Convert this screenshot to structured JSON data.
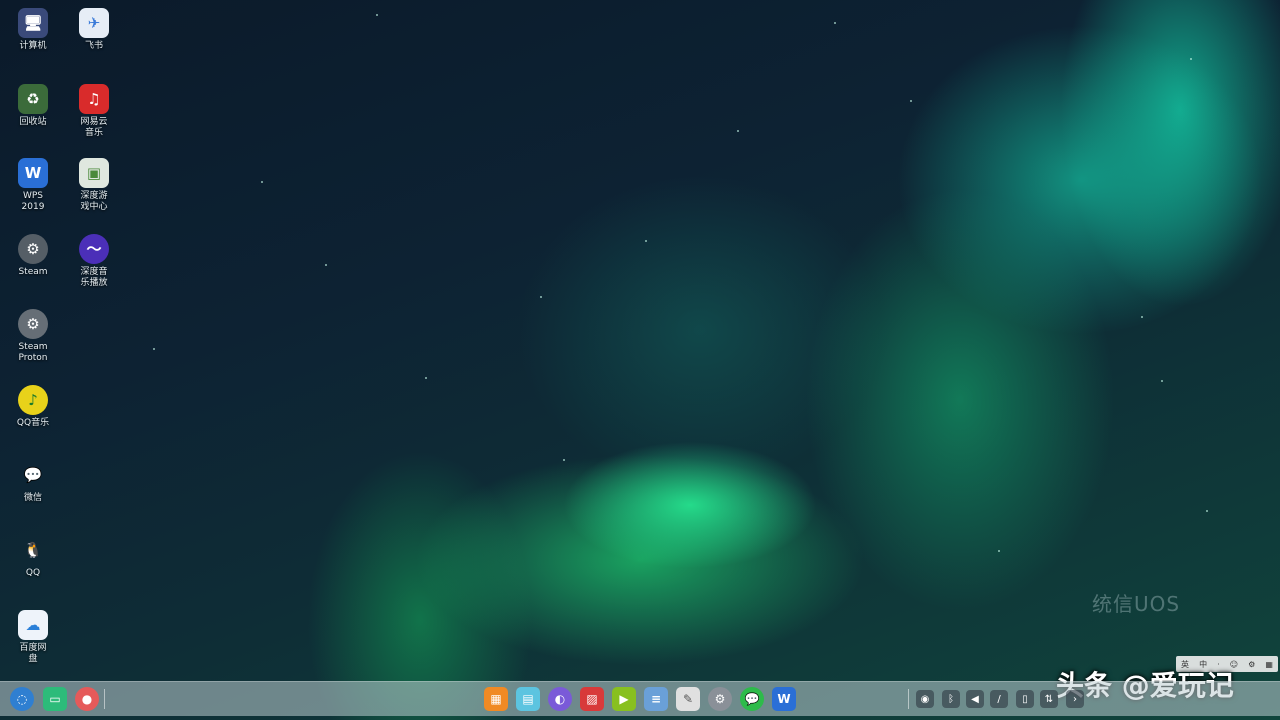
{
  "desktop": {
    "wallpaper_watermark": "统信UOS",
    "icons": [
      {
        "name": "computer",
        "label": "计算机",
        "glyph": "🖥",
        "color": "#3a4a7a"
      },
      {
        "name": "trash",
        "label": "回收站",
        "glyph": "♻",
        "color": "#3b6b3a"
      },
      {
        "name": "wps",
        "label": "WPS\n2019",
        "glyph": "W",
        "color": "#2a6fd6"
      },
      {
        "name": "steam",
        "label": "Steam",
        "glyph": "⚙",
        "color": "#555e66"
      },
      {
        "name": "steam-proton",
        "label": "Steam\nProton",
        "glyph": "⚙",
        "color": "#666e76"
      },
      {
        "name": "qq-music",
        "label": "QQ音乐",
        "glyph": "♪",
        "color": "#e8d21a"
      },
      {
        "name": "wechat",
        "label": "微信",
        "glyph": "💬",
        "color": "#2dbb4a"
      },
      {
        "name": "qq",
        "label": "QQ",
        "glyph": "🐧",
        "color": "#1a1a1a"
      },
      {
        "name": "baidu-netdisk",
        "label": "百度网\n盘",
        "glyph": "☁",
        "color": "#eef3fa"
      },
      {
        "name": "feishu",
        "label": "飞书",
        "glyph": "✈",
        "color": "#e6edf6"
      },
      {
        "name": "netease-music",
        "label": "网易云\n音乐",
        "glyph": "♫",
        "color": "#d92b2b"
      },
      {
        "name": "deepin-game",
        "label": "深度游\n戏中心",
        "glyph": "▣",
        "color": "#dfe7df"
      },
      {
        "name": "music-player",
        "label": "深度音\n乐播放",
        "glyph": "〜",
        "color": "#4b2fb8"
      }
    ]
  },
  "taskbar": {
    "left": [
      {
        "name": "launcher",
        "glyph": "◌",
        "color": "#2f7fd1"
      },
      {
        "name": "multitask",
        "glyph": "▭",
        "color": "#2dbb7a"
      },
      {
        "name": "record",
        "glyph": "●",
        "color": "#e55a5a"
      }
    ],
    "center": [
      {
        "name": "app-store",
        "glyph": "▦",
        "color": "#f08a24"
      },
      {
        "name": "file-manager",
        "glyph": "▤",
        "color": "#5cc4e0"
      },
      {
        "name": "browser",
        "glyph": "◐",
        "color": "#7a5ad8"
      },
      {
        "name": "image-viewer",
        "glyph": "▨",
        "color": "#d83a3a"
      },
      {
        "name": "video",
        "glyph": "▶",
        "color": "#88c020"
      },
      {
        "name": "document",
        "glyph": "≡",
        "color": "#6aa0d8"
      },
      {
        "name": "notes",
        "glyph": "✎",
        "color": "#e0e0e0"
      },
      {
        "name": "settings",
        "glyph": "⚙",
        "color": "#8a9098"
      },
      {
        "name": "wechat",
        "glyph": "💬",
        "color": "#2dbb4a"
      },
      {
        "name": "wps",
        "glyph": "W",
        "color": "#2a6fd6"
      }
    ],
    "tray": [
      {
        "name": "wechat-tray",
        "glyph": "◉"
      },
      {
        "name": "bluetooth",
        "glyph": "ᛒ"
      },
      {
        "name": "volume",
        "glyph": "◀"
      },
      {
        "name": "pen",
        "glyph": "/"
      },
      {
        "name": "clipboard",
        "glyph": "▯"
      },
      {
        "name": "network",
        "glyph": "⇅"
      },
      {
        "name": "arrow",
        "glyph": "›"
      }
    ]
  },
  "ime": {
    "items": [
      "英",
      "中",
      "·",
      "☺",
      "⚙",
      "▦"
    ]
  },
  "brand_watermark": "头条 @爱玩记"
}
